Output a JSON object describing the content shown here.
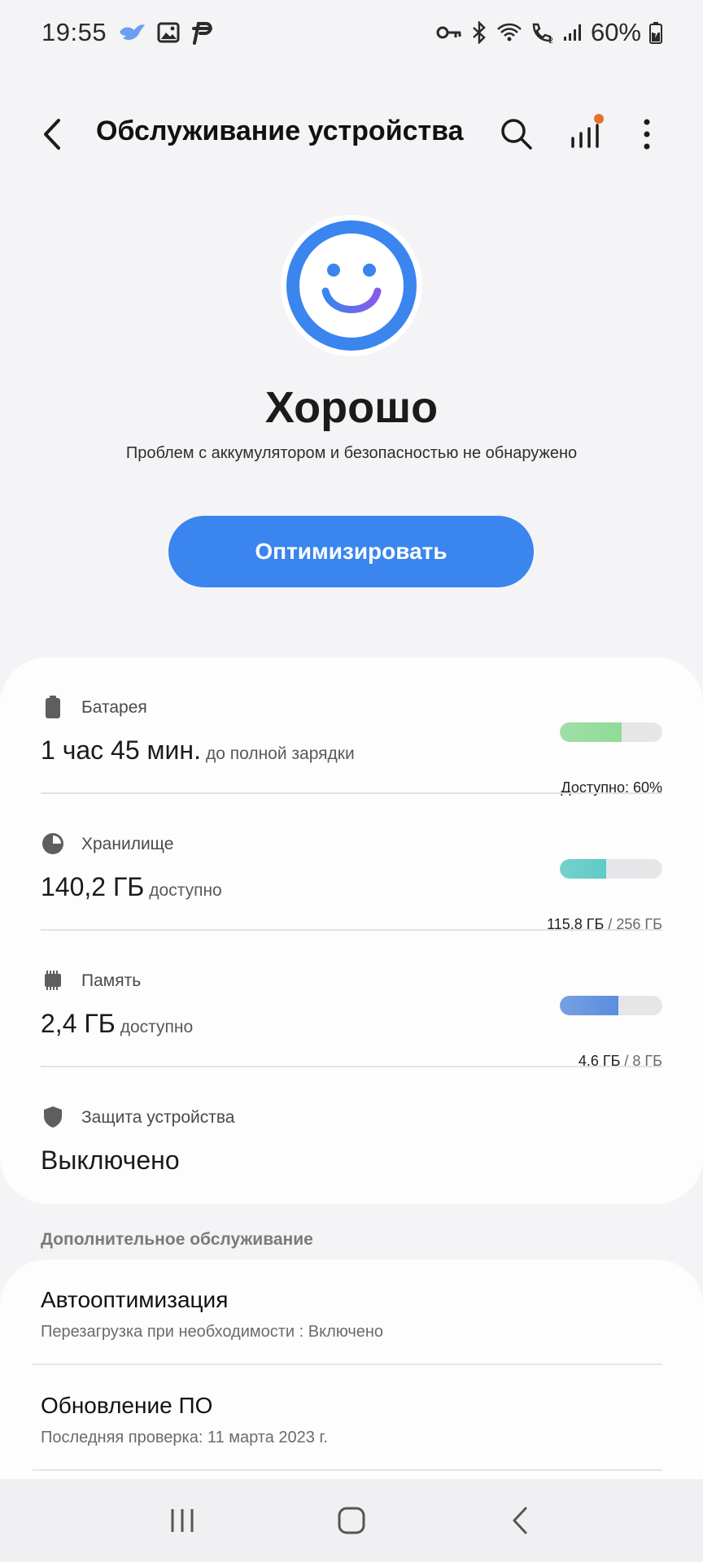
{
  "status_bar": {
    "time": "19:55",
    "battery_percent": "60%"
  },
  "header": {
    "title": "Обслуживание устройства"
  },
  "status": {
    "title": "Хорошо",
    "subtitle": "Проблем с аккумулятором и безопасностью не обнаружено",
    "optimize_label": "Оптимизировать",
    "accent_color": "#3a85ee"
  },
  "battery": {
    "label": "Батарея",
    "value": "1 час 45 мин.",
    "suffix": "до полной зарядки",
    "caption": "Доступно: 60%",
    "level": 0.6,
    "color": "#8fdc97"
  },
  "storage": {
    "label": "Хранилище",
    "value": "140,2 ГБ",
    "suffix": "доступно",
    "caption_used": "115,8 ГБ",
    "caption_total": "/ 256 ГБ",
    "level": 0.45,
    "color": "#5ccbc6"
  },
  "memory": {
    "label": "Память",
    "value": "2,4 ГБ",
    "suffix": "доступно",
    "caption_used": "4,6 ГБ",
    "caption_total": "/ 8 ГБ",
    "level": 0.575,
    "color": "#5b8ede"
  },
  "protection": {
    "label": "Защита устройства",
    "value": "Выключено"
  },
  "additional": {
    "header": "Дополнительное обслуживание",
    "items": [
      {
        "title": "Автооптимизация",
        "subtitle": "Перезагрузка при необходимости : Включено"
      },
      {
        "title": "Обновление ПО",
        "subtitle": "Последняя проверка: 11 марта 2023 г."
      }
    ]
  }
}
